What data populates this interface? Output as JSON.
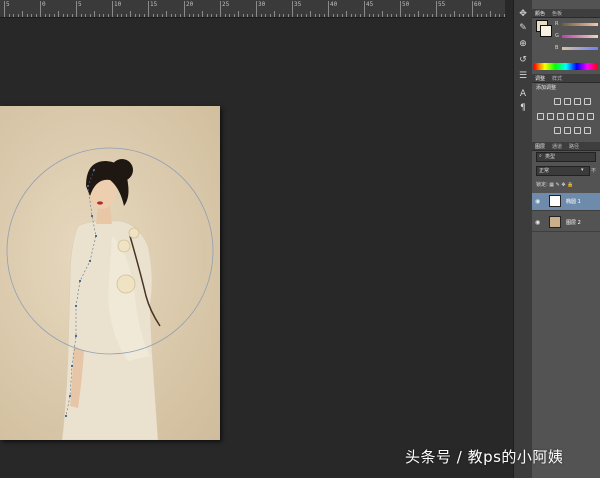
{
  "ruler": {
    "labels": [
      "5",
      "0",
      "5",
      "10",
      "15",
      "20",
      "25",
      "30",
      "35",
      "40",
      "45",
      "50",
      "55",
      "60"
    ]
  },
  "tools": {
    "icons": [
      "move-icon",
      "brush-icon",
      "stamp-icon",
      "history-brush-icon",
      "paragraph-icon",
      "text-icon",
      "paragraph-mark-icon"
    ]
  },
  "color_panel": {
    "tab_color": "颜色",
    "tab_swatches": "色板",
    "labels": [
      "R",
      "G",
      "B"
    ],
    "foreground": "#e9dcc2",
    "background": "#f7f1e4"
  },
  "adjust_panel": {
    "tab_adjust": "调整",
    "tab_style": "样式",
    "title": "添加调整"
  },
  "layers_panel": {
    "tab_layers": "图层",
    "tab_channels": "通道",
    "tab_paths": "路径",
    "kind_filter": "类型",
    "blend_mode": "正常",
    "opacity_label": "不",
    "lock_label": "锁定:",
    "layers": [
      {
        "name": "椭圆 1",
        "selected": true
      },
      {
        "name": "图层 2",
        "selected": false
      }
    ]
  },
  "watermark": "头条号 / 教ps的小阿姨"
}
